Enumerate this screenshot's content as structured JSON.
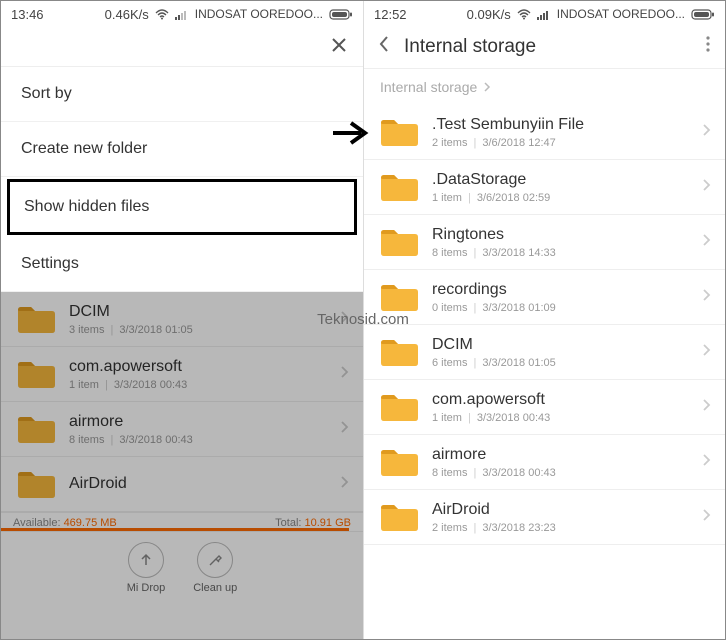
{
  "watermark": "Teknosid.com",
  "left": {
    "status": {
      "time": "13:46",
      "speed": "0.46K/s",
      "carrier": "INDOSAT OOREDOO..."
    },
    "menu": {
      "sort": "Sort by",
      "create": "Create new folder",
      "show_hidden": "Show hidden files",
      "settings": "Settings"
    },
    "files": [
      {
        "name": "DCIM",
        "items": "3 items",
        "date": "3/3/2018 01:05"
      },
      {
        "name": "com.apowersoft",
        "items": "1 item",
        "date": "3/3/2018 00:43"
      },
      {
        "name": "airmore",
        "items": "8 items",
        "date": "3/3/2018 00:43"
      },
      {
        "name": "AirDroid",
        "items": "",
        "date": ""
      }
    ],
    "storage": {
      "avail_lbl": "Available:",
      "avail_val": "469.75 MB",
      "total_lbl": "Total:",
      "total_val": "10.91 GB"
    },
    "actions": {
      "midrop": "Mi Drop",
      "cleanup": "Clean up"
    }
  },
  "right": {
    "status": {
      "time": "12:52",
      "speed": "0.09K/s",
      "carrier": "INDOSAT OOREDOO..."
    },
    "title": "Internal storage",
    "breadcrumb": "Internal storage",
    "files": [
      {
        "name": ".Test Sembunyiin File",
        "items": "2 items",
        "date": "3/6/2018 12:47"
      },
      {
        "name": ".DataStorage",
        "items": "1 item",
        "date": "3/6/2018 02:59"
      },
      {
        "name": "Ringtones",
        "items": "8 items",
        "date": "3/3/2018 14:33"
      },
      {
        "name": "recordings",
        "items": "0 items",
        "date": "3/3/2018 01:09"
      },
      {
        "name": "DCIM",
        "items": "6 items",
        "date": "3/3/2018 01:05"
      },
      {
        "name": "com.apowersoft",
        "items": "1 item",
        "date": "3/3/2018 00:43"
      },
      {
        "name": "airmore",
        "items": "8 items",
        "date": "3/3/2018 00:43"
      },
      {
        "name": "AirDroid",
        "items": "2 items",
        "date": "3/3/2018 23:23"
      }
    ]
  }
}
